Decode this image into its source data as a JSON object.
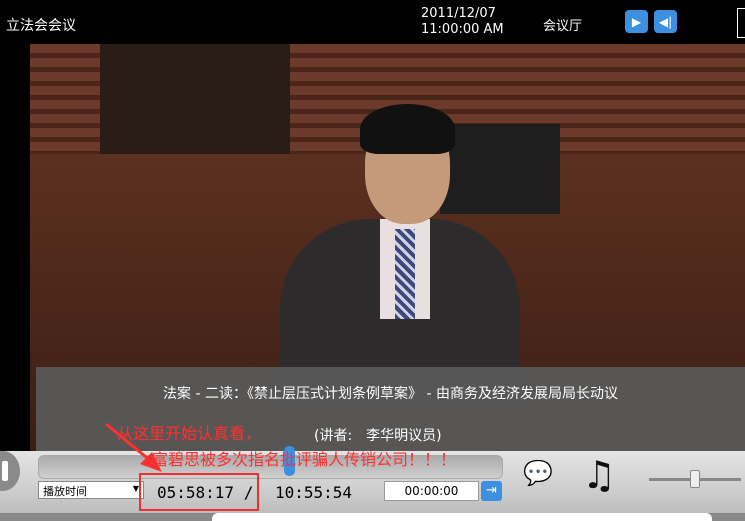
{
  "header": {
    "title": "立法会会议",
    "date": "2011/12/07",
    "time": "11:00:00 AM",
    "venue": "会议厅",
    "play_icon": "play-icon",
    "audio_icon": "audio-icon"
  },
  "caption": {
    "line1": "法案 - 二读：《禁止层压式计划条例草案》 - 由商务及经济发展局局长动议",
    "line2": "(讲者:　李华明议员)"
  },
  "annotation": {
    "line1": "从这里开始认真看，",
    "line2": "富碧思被多次指名批评骗人传销公司！！！",
    "color": "#ff3030"
  },
  "controls": {
    "mode_select": "播放时间",
    "current_time": "05:58:17",
    "separator": "/",
    "total_time": "10:55:54",
    "jump_input": "00:00:00",
    "progress_fraction": 0.55,
    "volume_fraction": 0.45,
    "accent": "#3d8fe0"
  }
}
